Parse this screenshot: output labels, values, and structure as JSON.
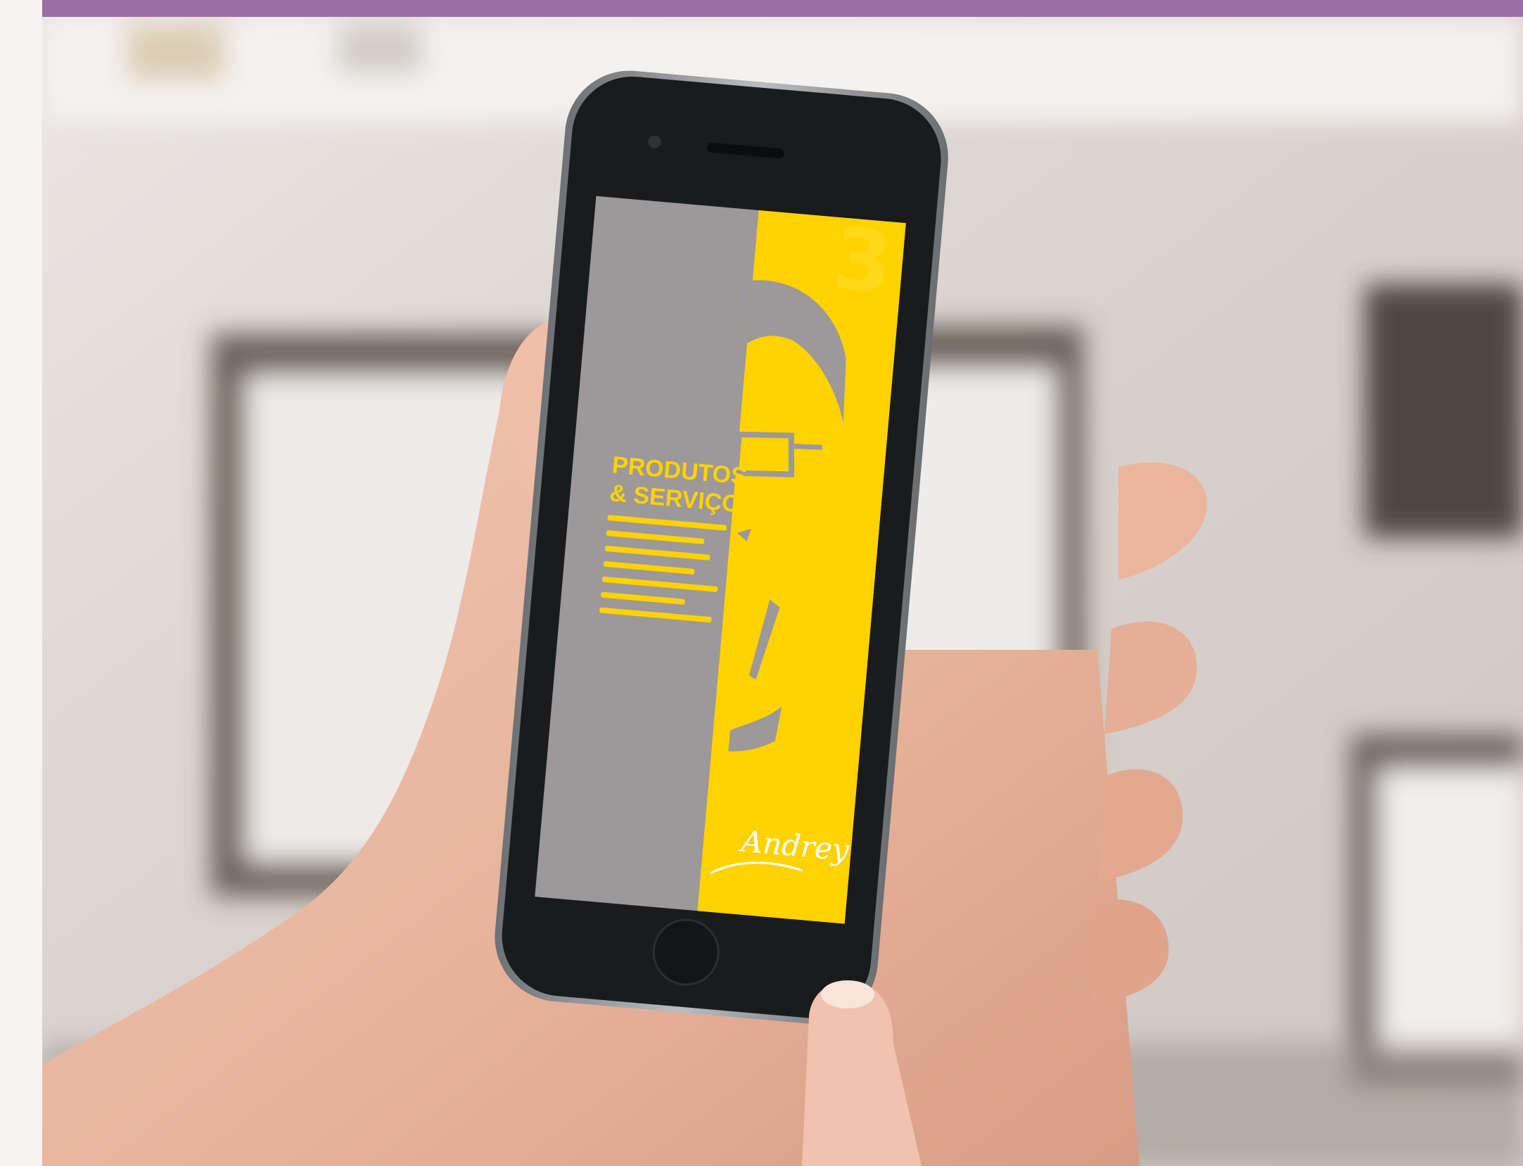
{
  "colors": {
    "top_bar": "#9b6ea6",
    "poster_gray": "#9d9899",
    "poster_yellow": "#ffd200",
    "skin": "#eab79e",
    "phone_body": "#1a1b1d"
  },
  "poster": {
    "number": "3",
    "title_line1": "PRODUTOS",
    "title_line2": "& SERVIÇOS",
    "signature": "Andrey"
  }
}
